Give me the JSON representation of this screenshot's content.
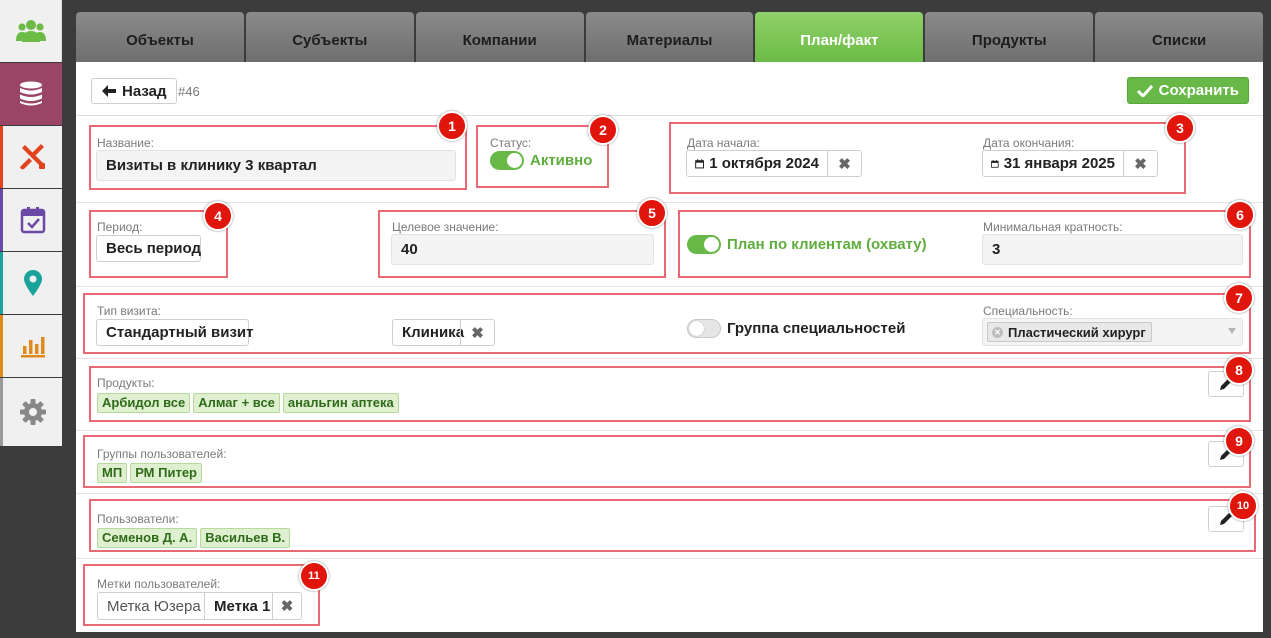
{
  "sidebar": {
    "items": [
      {
        "icon": "users-icon",
        "bg": "#f0f0f0",
        "accent": "#6cbb45"
      },
      {
        "icon": "database-icon",
        "bg": "#9a4466",
        "accent": "#ffffff"
      },
      {
        "icon": "tools-icon",
        "bg": "#f0f0f0",
        "accent": "#e2431f"
      },
      {
        "icon": "calendar-check-icon",
        "bg": "#f0f0f0",
        "accent": "#6b4aa6"
      },
      {
        "icon": "map-marker-icon",
        "bg": "#f0f0f0",
        "accent": "#1aa39a"
      },
      {
        "icon": "bar-chart-icon",
        "bg": "#f0f0f0",
        "accent": "#e08a1e"
      },
      {
        "icon": "gear-icon",
        "bg": "#f0f0f0",
        "accent": "#888888"
      }
    ]
  },
  "tabs": [
    {
      "label": "Объекты",
      "active": false
    },
    {
      "label": "Субъекты",
      "active": false
    },
    {
      "label": "Компании",
      "active": false
    },
    {
      "label": "Материалы",
      "active": false
    },
    {
      "label": "План/факт",
      "active": true
    },
    {
      "label": "Продукты",
      "active": false
    },
    {
      "label": "Списки",
      "active": false
    }
  ],
  "toolbar": {
    "back_label": "Назад",
    "record_id": "#46",
    "save_label": "Сохранить"
  },
  "form": {
    "name": {
      "label": "Название:",
      "value": "Визиты в клинику 3 квартал"
    },
    "status": {
      "label": "Статус:",
      "value": "Активно",
      "on": true
    },
    "start_date": {
      "label": "Дата начала:",
      "value": "1 октября 2024"
    },
    "end_date": {
      "label": "Дата окончания:",
      "value": "31 января 2025"
    },
    "period": {
      "label": "Период:",
      "value": "Весь период"
    },
    "target": {
      "label": "Целевое значение:",
      "value": "40"
    },
    "client_plan": {
      "label": "План по клиентам (охвату)",
      "on": true
    },
    "min_multiplicity": {
      "label": "Минимальная кратность:",
      "value": "3"
    },
    "visit_type": {
      "label": "Тип визита:",
      "value": "Стандартный визит"
    },
    "visit_place": {
      "value": "Клиника"
    },
    "specialty_group": {
      "label": "Группа специальностей",
      "on": false
    },
    "specialty": {
      "label": "Специальность:",
      "value": "Пластический хирург"
    },
    "products": {
      "label": "Продукты:",
      "items": [
        "Арбидол все",
        "Алмаг + все",
        "анальгин аптека"
      ]
    },
    "user_groups": {
      "label": "Группы пользователей:",
      "items": [
        "МП",
        "РМ Питер"
      ]
    },
    "users": {
      "label": "Пользователи:",
      "items": [
        "Семенов Д. А.",
        "Васильев В."
      ]
    },
    "user_tags": {
      "label": "Метки пользователей:",
      "placeholder": "Метка Юзера",
      "value": "Метка 1"
    }
  },
  "annotations": [
    "1",
    "2",
    "3",
    "4",
    "5",
    "6",
    "7",
    "8",
    "9",
    "10",
    "11"
  ]
}
